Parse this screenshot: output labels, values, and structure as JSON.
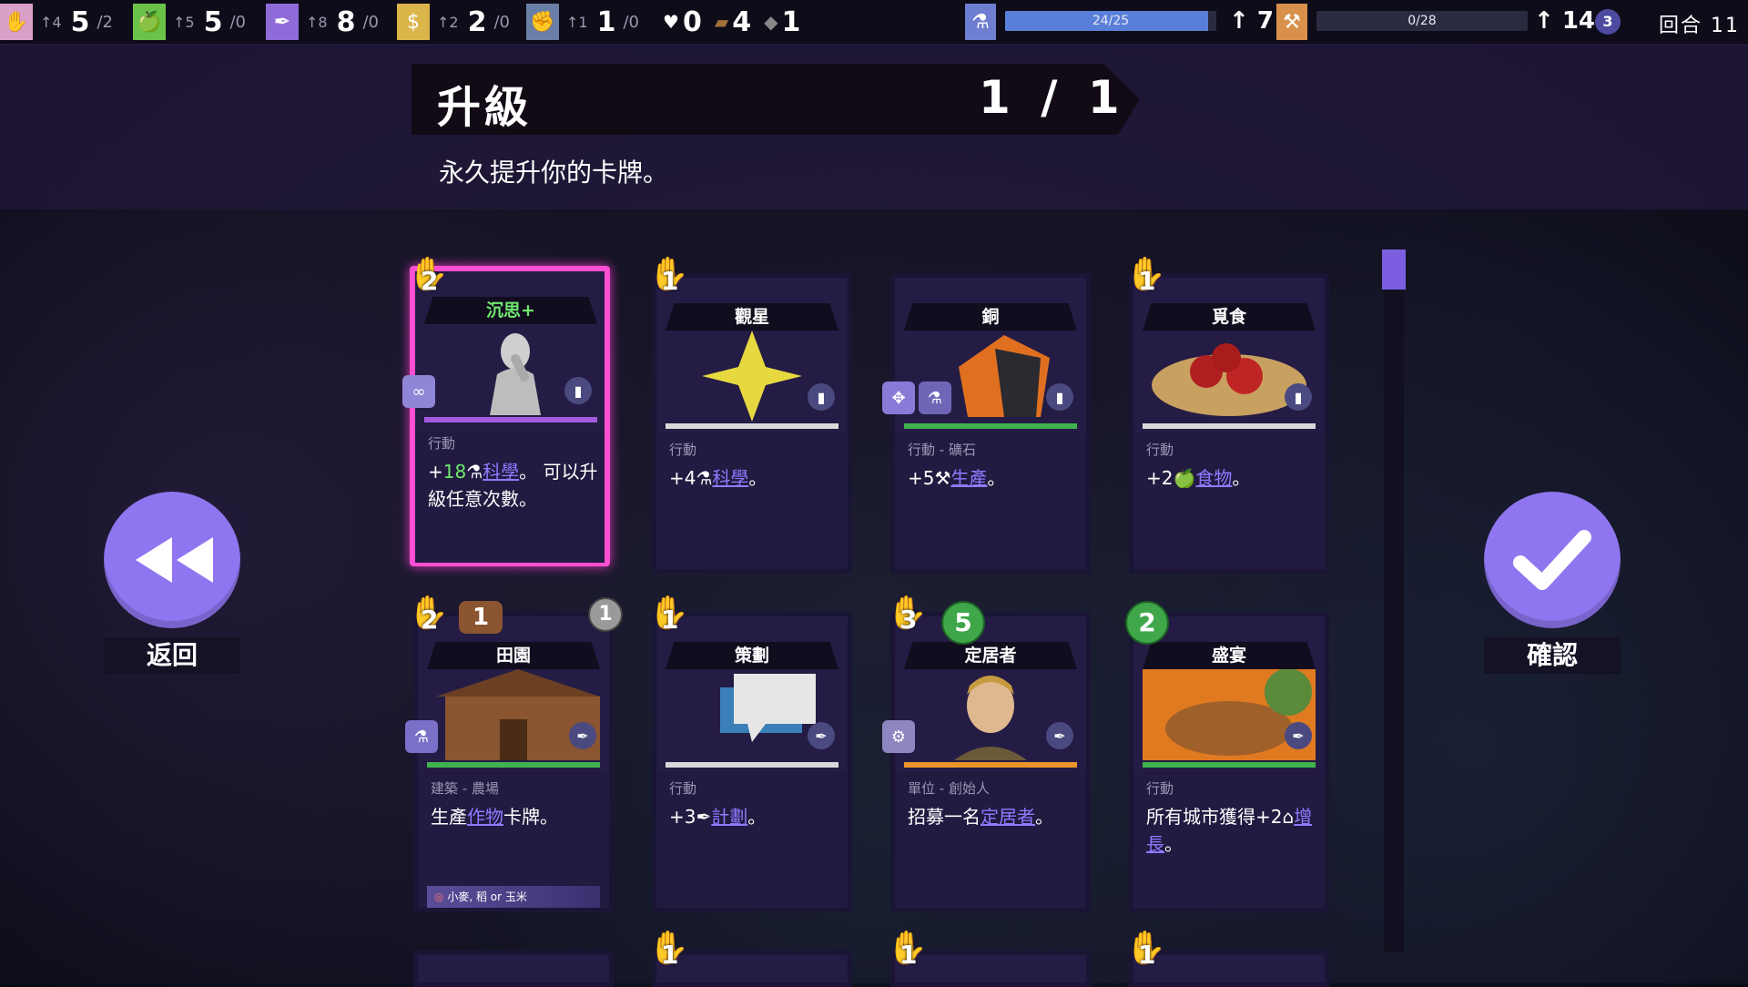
{
  "topbar": {
    "resources": [
      {
        "icon": "hand-icon",
        "color": "#d9a0c8",
        "gain": "↑4",
        "value": "5",
        "cap": "/2"
      },
      {
        "icon": "apple-icon",
        "color": "#6ac24a",
        "gain": "↑5",
        "value": "5",
        "cap": "/0"
      },
      {
        "icon": "quill-icon",
        "color": "#8e6bd8",
        "gain": "↑8",
        "value": "8",
        "cap": "/0"
      },
      {
        "icon": "money-bag-icon",
        "color": "#d9b54a",
        "gain": "↑2",
        "value": "2",
        "cap": "/0"
      },
      {
        "icon": "fist-icon",
        "color": "#6a7fa8",
        "gain": "↑1",
        "value": "1",
        "cap": "/0"
      }
    ],
    "misc": [
      {
        "icon": "heart-icon",
        "value": "0"
      },
      {
        "icon": "wood-icon",
        "value": "4"
      },
      {
        "icon": "stone-icon",
        "value": "1"
      }
    ],
    "science": {
      "bar_text": "24/25",
      "fraction": 0.96,
      "rate": "↑ 7"
    },
    "production": {
      "bar_text": "0/28",
      "fraction": 0.0,
      "rate": "↑ 14"
    },
    "badge": "3",
    "turn": "回合 11"
  },
  "header": {
    "title": "升級",
    "counter": "1 / 1",
    "subtitle": "永久提升你的卡牌。"
  },
  "buttons": {
    "back": "返回",
    "confirm": "確認"
  },
  "cards": [
    {
      "name": "沉思+",
      "type": "行動",
      "desc_prefix": "+",
      "desc_num": "18",
      "desc_link": "科學",
      "desc_suffix": "。 可以升級任意次數。",
      "hand": "2"
    },
    {
      "name": "觀星",
      "type": "行動",
      "desc_prefix": "+4",
      "desc_link": "科學",
      "desc_suffix": "。",
      "hand": "1"
    },
    {
      "name": "銅",
      "type": "行動 - 礦石",
      "desc_prefix": "+5",
      "desc_link": "生產",
      "desc_suffix": "。",
      "hand": ""
    },
    {
      "name": "覓食",
      "type": "行動",
      "desc_prefix": "+2",
      "desc_link": "食物",
      "desc_suffix": "。",
      "hand": "1"
    },
    {
      "name": "田園",
      "type": "建築 - 農場",
      "desc_prefix": "生產",
      "desc_link": "作物",
      "desc_suffix": "卡牌。",
      "hand": "2",
      "wood": "1",
      "stone": "1",
      "footer": "小麥, 稻 or 玉米"
    },
    {
      "name": "策劃",
      "type": "行動",
      "desc_prefix": "+3",
      "desc_link": "計劃",
      "desc_suffix": "。",
      "hand": "1"
    },
    {
      "name": "定居者",
      "type": "單位 - 創始人",
      "desc_prefix": "招募一名",
      "desc_link": "定居者",
      "desc_suffix": "。",
      "hand": "3",
      "food": "5"
    },
    {
      "name": "盛宴",
      "type": "行動",
      "desc_prefix": "所有城市獲得+2",
      "desc_link": "增長",
      "desc_suffix": "。",
      "hand": "",
      "food": "2"
    }
  ],
  "peek_hands": [
    "1",
    "1",
    "1"
  ],
  "colors": {
    "accent": "#8f76f0",
    "selected": "#ff4fd2",
    "link": "#8c7bff",
    "food": "#3fa64a"
  }
}
